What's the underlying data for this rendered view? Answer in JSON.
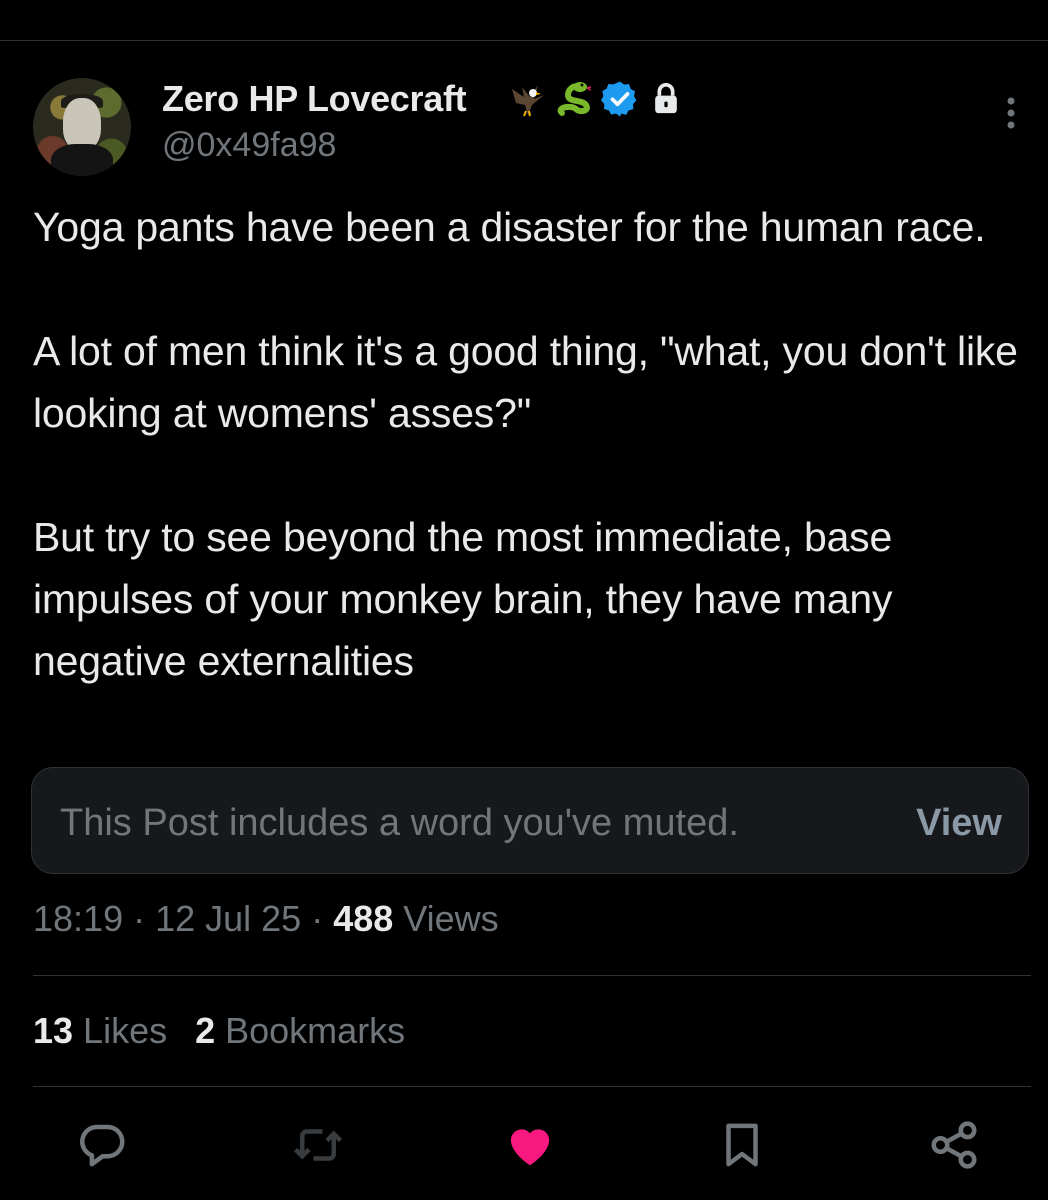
{
  "author": {
    "display_name": "Zero HP Lovecraft",
    "handle": "@0x49fa98",
    "badges": [
      "eagle-emoji",
      "snake-emoji",
      "verified-badge-icon",
      "lock-icon"
    ]
  },
  "tweet": {
    "paragraphs": [
      "Yoga pants have been a disaster for the human race.",
      "A lot of men think it's a good thing, \"what, you don't like looking at womens' asses?\"",
      "But try to see beyond the most immediate, base impulses of your monkey brain, they have many negative externalities"
    ]
  },
  "muted_notice": {
    "text": "This Post includes a word you've muted.",
    "button": "View"
  },
  "meta": {
    "time": "18:19",
    "sep1": " · ",
    "date": "12 Jul 25",
    "sep2": " · ",
    "views_count": "488",
    "views_label": " Views"
  },
  "stats": {
    "likes_count": "13",
    "likes_label": " Likes",
    "bookmarks_count": "2",
    "bookmarks_label": " Bookmarks"
  },
  "actions": [
    "reply-icon",
    "repost-icon",
    "like-icon",
    "bookmark-icon",
    "share-icon"
  ],
  "colors": {
    "background": "#000000",
    "text": "#e7e9ea",
    "secondary": "#71767b",
    "verified": "#1d9bf0",
    "like_active": "#f91880"
  }
}
